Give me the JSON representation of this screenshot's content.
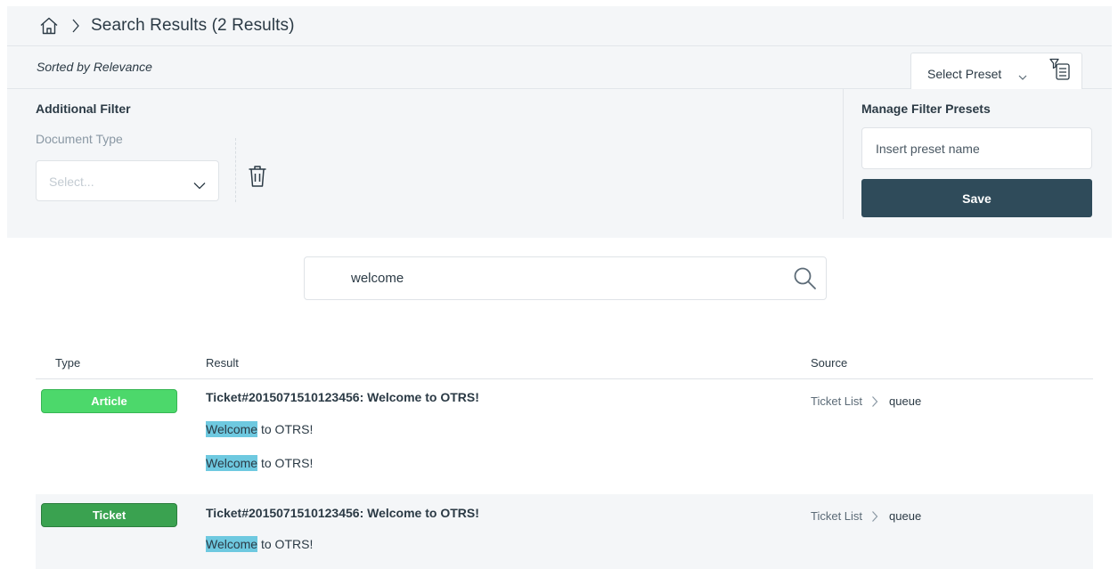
{
  "header": {
    "title": "Search Results (2 Results)"
  },
  "toolbar": {
    "sorted_label": "Sorted by Relevance",
    "preset_label": "Select Preset"
  },
  "filter": {
    "title": "Additional Filter",
    "document_type_label": "Document Type",
    "document_type_placeholder": "Select..."
  },
  "presets": {
    "title": "Manage Filter Presets",
    "input_placeholder": "Insert preset name",
    "save_label": "Save"
  },
  "search": {
    "value": "welcome"
  },
  "table": {
    "columns": [
      "Type",
      "Result",
      "Source"
    ],
    "rows": [
      {
        "type": "Article",
        "title": "Ticket#2015071510123456: Welcome to OTRS!",
        "snippets": [
          {
            "highlight": "Welcome",
            "rest": " to OTRS!"
          },
          {
            "highlight": "Welcome",
            "rest": " to OTRS!"
          }
        ],
        "source_parent": "Ticket List",
        "source_child": "queue"
      },
      {
        "type": "Ticket",
        "title": "Ticket#2015071510123456: Welcome to OTRS!",
        "snippets": [
          {
            "highlight": "Welcome",
            "rest": " to OTRS!"
          }
        ],
        "source_parent": "Ticket List",
        "source_child": "queue"
      }
    ]
  },
  "colors": {
    "primary_button": "#2f4b5a",
    "article_badge": "#4cd86b",
    "ticket_badge": "#3aa250",
    "highlight": "#6ec9e0",
    "panel_bg": "#f4f6f8"
  },
  "icons": {
    "home": "home-icon",
    "breadcrumb_separator": "chevron-right-icon",
    "preset_dropdown": "chevron-down-icon",
    "filter_list": "filter-list-icon",
    "trash": "trash-icon",
    "search": "search-icon"
  }
}
